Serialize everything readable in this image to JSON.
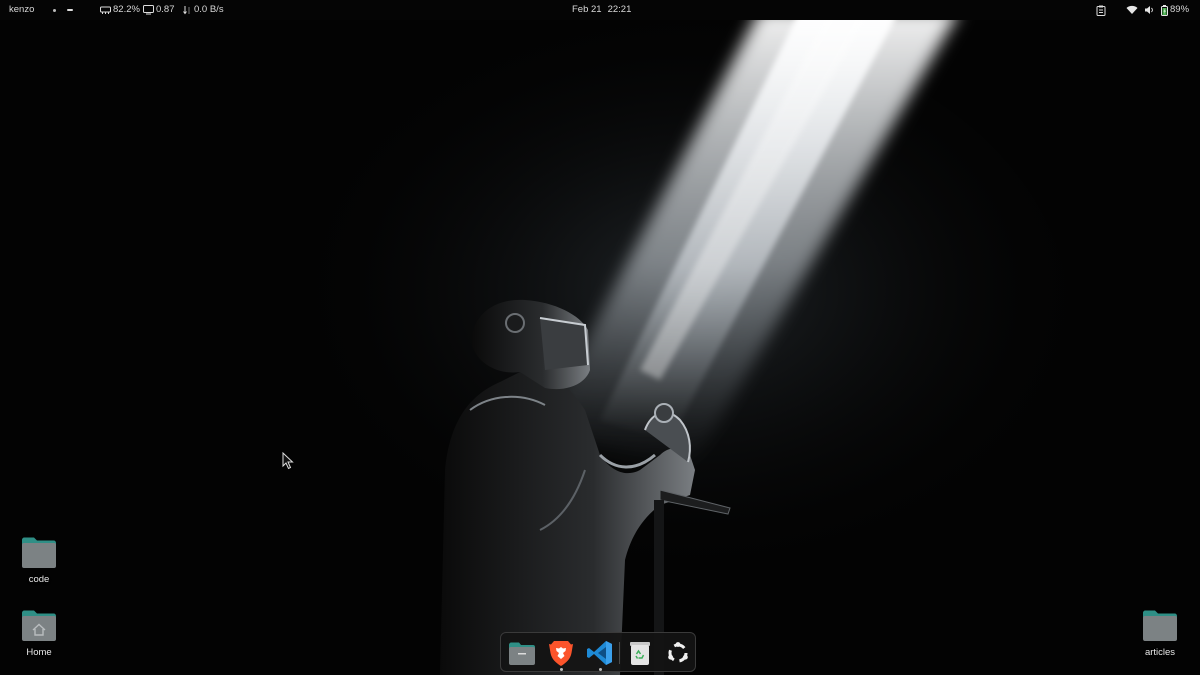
{
  "topbar": {
    "user": "kenzo",
    "ram": "82.2%",
    "load": "0.87",
    "net": "0.0 B/s",
    "date": "Feb 21",
    "time": "22:21",
    "battery": "89%"
  },
  "desktop_icons": {
    "code": "code",
    "home": "Home",
    "articles": "articles"
  },
  "dock": {
    "files": "Files",
    "brave": "Brave",
    "vscode": "Visual Studio Code",
    "trash": "Trash",
    "apps": "Show Applications"
  },
  "colors": {
    "folder_body": "#7c8284",
    "folder_tab": "#2f8f86",
    "brave": "#fb542b",
    "vscode": "#1e8ad6"
  }
}
